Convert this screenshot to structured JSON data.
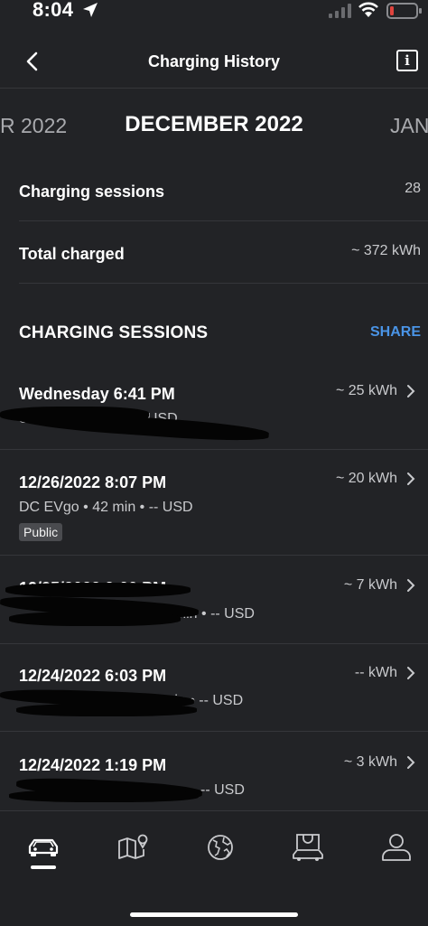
{
  "status_bar": {
    "time": "8:04",
    "icons": [
      "location-arrow-icon",
      "cellular-signal-icon",
      "wifi-icon",
      "battery-low-icon"
    ]
  },
  "nav": {
    "title": "Charging History",
    "back_icon": "chevron-left-icon",
    "info_icon": "info-icon",
    "info_glyph": "i"
  },
  "months": {
    "prev": "R 2022",
    "current": "DECEMBER 2022",
    "next": "JANU"
  },
  "summary": {
    "sessions_label": "Charging sessions",
    "sessions_value": "28",
    "total_label": "Total charged",
    "total_value": "~ 372 kWh"
  },
  "sessions_section": {
    "title": "CHARGING SESSIONS",
    "share_label": "SHARE"
  },
  "sessions": [
    {
      "title": "Wednesday 6:41 PM",
      "energy": "~ 25 kWh",
      "detail": "Sc... • 4h 18min • -- USD",
      "tag": ""
    },
    {
      "title": "12/26/2022 8:07 PM",
      "energy": "~ 20 kWh",
      "detail": "DC EVgo • 42 min • -- USD",
      "tag": "Public"
    },
    {
      "title": "12/25/2022 2:00 PM",
      "energy": "~ 7 kWh",
      "detail": "26min • -- USD",
      "tag": ""
    },
    {
      "title": "12/24/2022 6:03 PM",
      "energy": "-- kWh",
      "detail": "min • -- USD",
      "tag": ""
    },
    {
      "title": "12/24/2022 1:19 PM",
      "energy": "~ 3 kWh",
      "detail": "-- USD",
      "tag": ""
    }
  ],
  "tab_bar": {
    "tabs": [
      "car-icon",
      "map-pin-icon",
      "globe-icon",
      "shop-car-icon",
      "profile-icon"
    ],
    "active": "car-icon"
  },
  "colors": {
    "background": "#222326",
    "accent": "#4a94e6",
    "divider": "#35363a",
    "secondary_text": "#c9cacd"
  }
}
